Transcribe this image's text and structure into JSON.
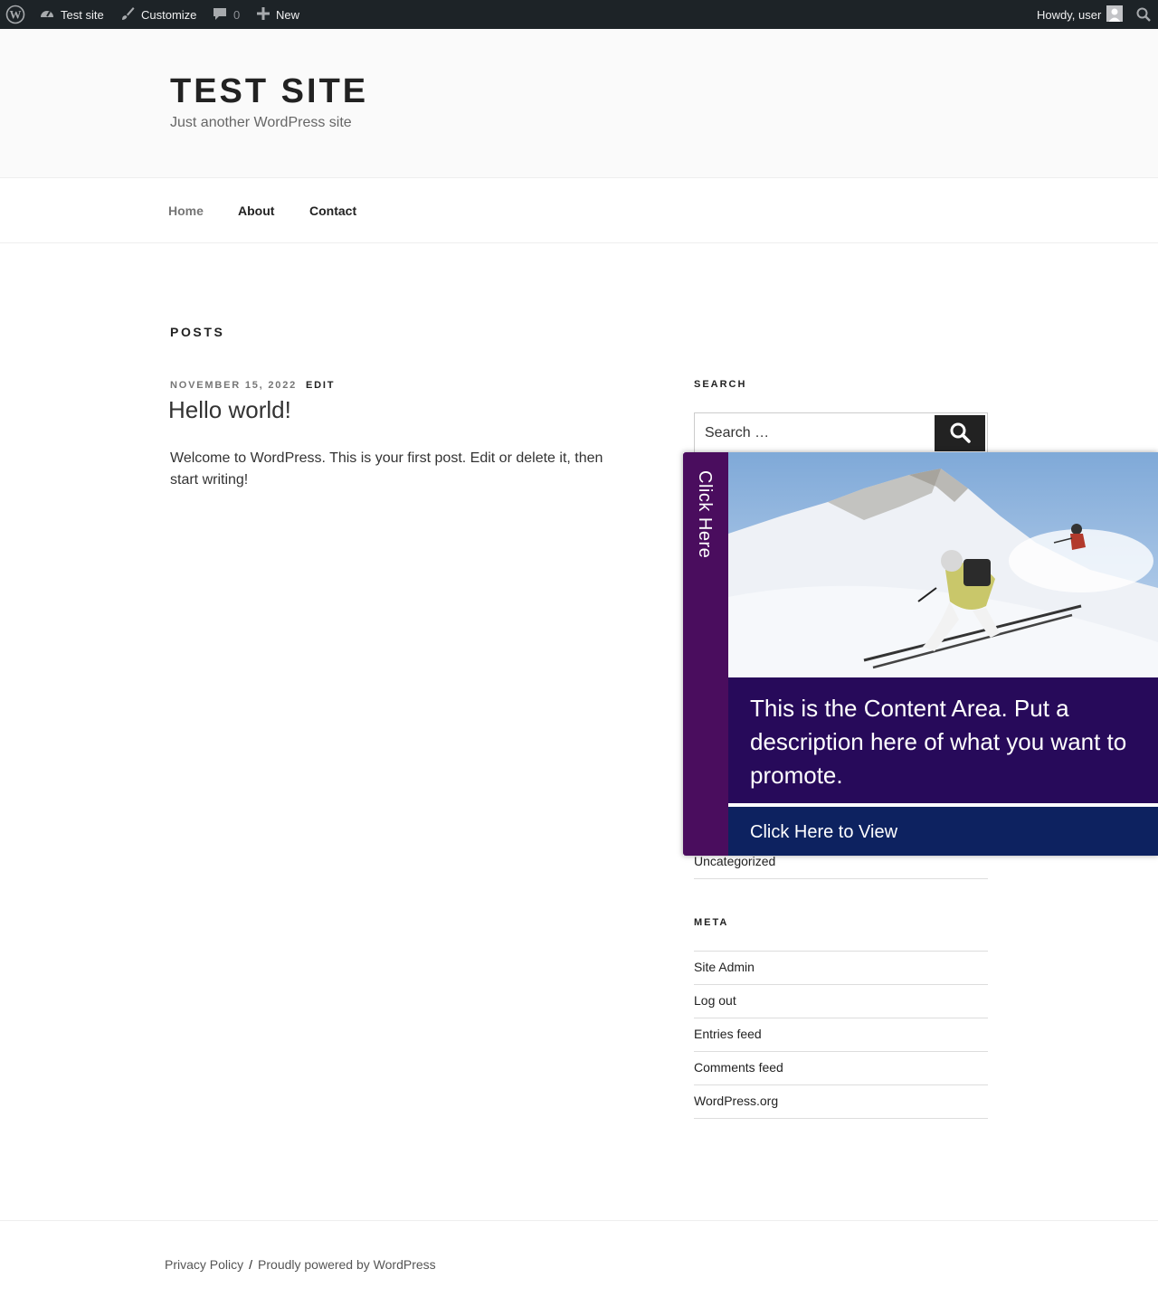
{
  "adminbar": {
    "site_name": "Test site",
    "customize": "Customize",
    "comments_count": "0",
    "new_label": "New",
    "howdy": "Howdy, user"
  },
  "header": {
    "title": "TEST SITE",
    "tagline": "Just another WordPress site"
  },
  "nav": {
    "items": [
      {
        "label": "Home"
      },
      {
        "label": "About"
      },
      {
        "label": "Contact"
      }
    ]
  },
  "main": {
    "heading": "POSTS",
    "post": {
      "date": "NOVEMBER 15, 2022",
      "edit": "EDIT",
      "title": "Hello world!",
      "body": "Welcome to WordPress. This is your first post. Edit or delete it, then start writing!"
    }
  },
  "sidebar": {
    "search_title": "SEARCH",
    "search_placeholder": "Search …",
    "category_visible": "Uncategorized",
    "meta_title": "META",
    "meta_links": [
      "Site Admin",
      "Log out",
      "Entries feed",
      "Comments feed",
      "WordPress.org"
    ]
  },
  "promo": {
    "tab_label": "Click Here",
    "content": "This is the Content Area. Put a description here of what you want to promote.",
    "cta": "Click Here to View",
    "colors": {
      "tab": "#4a0d5e",
      "content": "#270a5a",
      "cta": "#0d2260"
    }
  },
  "footer": {
    "privacy": "Privacy Policy",
    "separator": "/",
    "powered": "Proudly powered by WordPress"
  }
}
